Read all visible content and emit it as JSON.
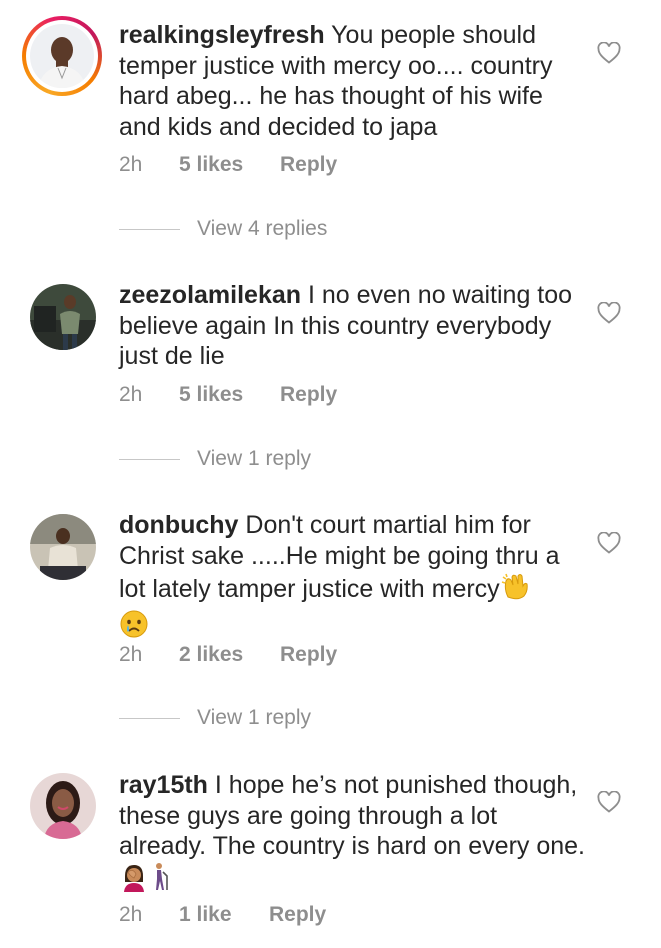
{
  "comments": [
    {
      "username": "realkingsleyfresh",
      "text": "You people should temper justice with mercy oo.... country hard abeg... he has thought of his wife and kids and decided to japa",
      "time": "2h",
      "likes": "5 likes",
      "reply": "Reply",
      "view_replies": "View 4 replies",
      "has_story_ring": true
    },
    {
      "username": "zeezolamilekan",
      "text": "I no even no waiting too believe again In this country everybody just de lie",
      "time": "2h",
      "likes": "5 likes",
      "reply": "Reply",
      "view_replies": "View 1 reply",
      "has_story_ring": false
    },
    {
      "username": "donbuchy",
      "text": "Don't court martial him for Christ sake .....He might be going thru a lot lately tamper justice with mercy",
      "emojis": [
        "clapping-hands-emoji",
        "crying-face-emoji"
      ],
      "time": "2h",
      "likes": "2 likes",
      "reply": "Reply",
      "view_replies": "View 1 reply",
      "has_story_ring": false
    },
    {
      "username": "ray15th",
      "text": "I hope he’s not punished though, these guys are going through a lot already. The country is hard on every one.",
      "emojis": [
        "woman-facepalming-emoji",
        "person-walking-with-cane-emoji"
      ],
      "time": "2h",
      "likes": "1 like",
      "reply": "Reply",
      "has_story_ring": false
    }
  ],
  "colors": {
    "text": "#262626",
    "muted": "#8e8e8e",
    "divider": "#c7c7c7"
  }
}
